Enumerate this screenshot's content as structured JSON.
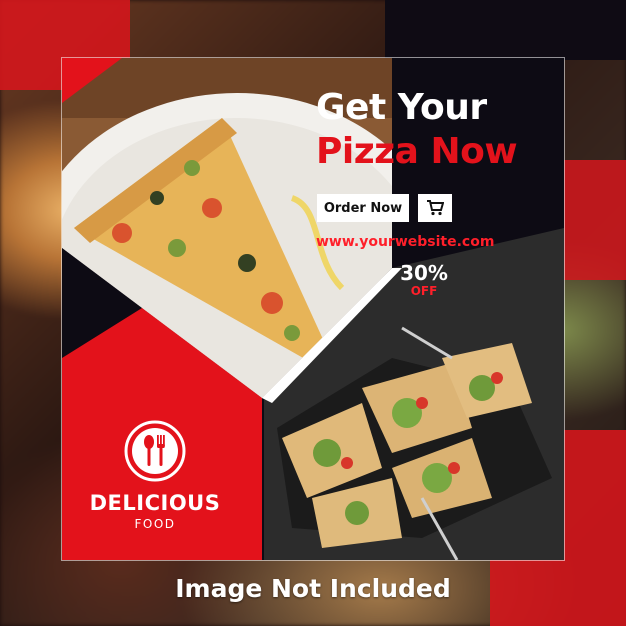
{
  "headline": {
    "line1": "Get Your",
    "line2": "Pizza Now"
  },
  "cta": {
    "order_label": "Order Now",
    "cart_icon": "cart-icon"
  },
  "website": "www.yourwebsite.com",
  "discount": {
    "percent": "30%",
    "label": "OFF"
  },
  "brand": {
    "name": "DELICIOUS",
    "tagline": "FOOD",
    "logo_icon": "spoon-fork-icon"
  },
  "caption": "Image Not Included",
  "colors": {
    "accent_red": "#e3121b",
    "dark": "#0d0b14",
    "white": "#ffffff"
  }
}
